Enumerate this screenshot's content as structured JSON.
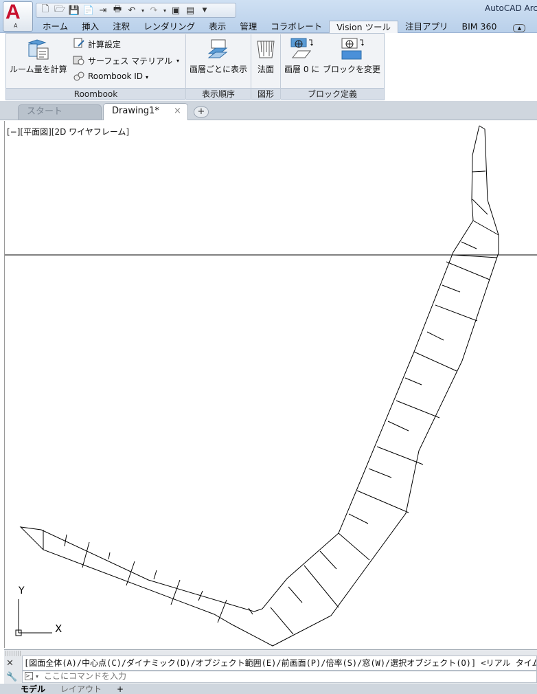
{
  "app": {
    "title": "AutoCAD Arc",
    "menu_letter": "A",
    "menu_sub": "A"
  },
  "quick_access": {
    "icons": [
      "new-icon",
      "open-icon",
      "save-icon",
      "save-as-icon",
      "export-icon",
      "plot-icon",
      "undo-icon",
      "redo-icon",
      "workspace-icon",
      "layer-icon",
      "customize-icon"
    ]
  },
  "ribbon_tabs": [
    "ホーム",
    "挿入",
    "注釈",
    "レンダリング",
    "表示",
    "管理",
    "コラボレート",
    "Vision ツール",
    "注目アプリ",
    "BIM 360"
  ],
  "active_ribbon_tab": "Vision ツール",
  "ribbon": {
    "roombook": {
      "large_button": "ルーム量を計算",
      "small_buttons": [
        "計算設定",
        "サーフェス マテリアル",
        "Roombook ID"
      ],
      "panel_label": "Roombook"
    },
    "display_order": {
      "button": "画層ごとに表示",
      "panel_label": "表示順序"
    },
    "shapes": {
      "button": "法面",
      "panel_label": "図形"
    },
    "block_def": {
      "button1": "画層 0 に",
      "button2": "ブロックを変更",
      "panel_label": "ブロック定義"
    }
  },
  "file_tabs": {
    "start": "スタート",
    "drawing": "Drawing1*",
    "close": "×",
    "add": "+"
  },
  "viewport": {
    "label": "[−][平面図][2D ワイヤフレーム]",
    "ucs_y": "Y",
    "ucs_x": "X"
  },
  "command_line": {
    "history": "[図面全体(A)/中心点(C)/ダイナミック(D)/オブジェクト範囲(E)/前画面(P)/倍率(S)/窓(W)/選択オブジェクト(O)] <リアル タイム>: _e モ",
    "placeholder": "ここにコマンドを入力"
  },
  "layout_tabs": [
    "モデル",
    "レイアウト",
    "+"
  ],
  "colors": {
    "app_red": "#c8102e",
    "ribbon_blue": "#4a90d9"
  }
}
